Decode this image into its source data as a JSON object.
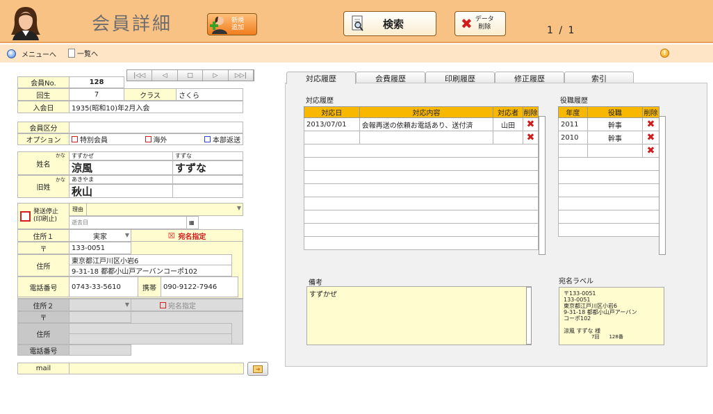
{
  "header": {
    "title": "会員詳細",
    "new_label_1": "新規",
    "new_label_2": "追加",
    "search_label": "検索",
    "delete_label_1": "データ",
    "delete_label_2": "削除",
    "record_counter": "1 / 1"
  },
  "nav": {
    "menu": "メニューへ",
    "list": "一覧へ"
  },
  "member": {
    "no_label": "会員No.",
    "no": "128",
    "kai_label": "回生",
    "kai": "7",
    "class_label": "クラス",
    "class": "さくら",
    "join_label": "入会日",
    "join": "1935(昭和10)年2月入会"
  },
  "kubun": {
    "label": "会員区分",
    "option_label": "オプション",
    "opt1": "特別会員",
    "opt2": "海外",
    "opt3": "本部返送"
  },
  "name": {
    "label": "姓名",
    "kana_tag": "かな",
    "sei_kana": "すずかぜ",
    "sei": "涼風",
    "mei_kana": "すずな",
    "mei": "すずな",
    "old_label": "旧姓",
    "old_kana": "あきやま",
    "old": "秋山"
  },
  "stop": {
    "label_1": "発送停止",
    "label_2": "(印刷止)",
    "reason_label": "理由",
    "death_label": "逝去日"
  },
  "addr1": {
    "label": "住所１",
    "type": "実家",
    "atena": "宛名指定",
    "zip_label": "〒",
    "zip": "133-0051",
    "addr_label": "住所",
    "line1": "東京都江戸川区小岩6",
    "line2": "9-31-18  都都小山戸アーバンコーポ102",
    "tel_label": "電話番号",
    "tel": "0743-33-5610",
    "mobile_label": "携帯",
    "mobile": "090-9122-7946"
  },
  "addr2": {
    "label": "住所２",
    "atena": "宛名指定",
    "zip_label": "〒",
    "addr_label": "住所",
    "tel_label": "電話番号"
  },
  "mail": {
    "label": "mail",
    "value": ""
  },
  "tabs": [
    "対応履歴",
    "会費履歴",
    "印刷履歴",
    "修正履歴",
    "索引"
  ],
  "history": {
    "title": "対応履歴",
    "headers": [
      "対応日",
      "対応内容",
      "対応者",
      "削除"
    ],
    "row1": {
      "date": "2013/07/01",
      "content": "会報再送の依頼お電話あり、送付済",
      "person": "山田"
    }
  },
  "roles": {
    "title": "役職履歴",
    "headers": [
      "年度",
      "役職",
      "削除"
    ],
    "row1": {
      "year": "2011",
      "role": "幹事"
    },
    "row2": {
      "year": "2010",
      "role": "幹事"
    }
  },
  "memo": {
    "title": "備考",
    "text": "すずかぜ"
  },
  "label": {
    "title": "宛名ラベル",
    "l1": "〒133-0051",
    "l2": "133-0051",
    "l3": "東京都江戸川区小岩6",
    "l4": "9-31-18  都都小山戸アーバン",
    "l5": "コーポ102",
    "l6": "涼風  すずな 様",
    "l7": "7回　　128番"
  },
  "colors": {
    "header_bg": "#f9c285",
    "navbar_bg": "#fde5c6",
    "table_header": "#f8b800",
    "delete_red": "#d21c1c"
  }
}
